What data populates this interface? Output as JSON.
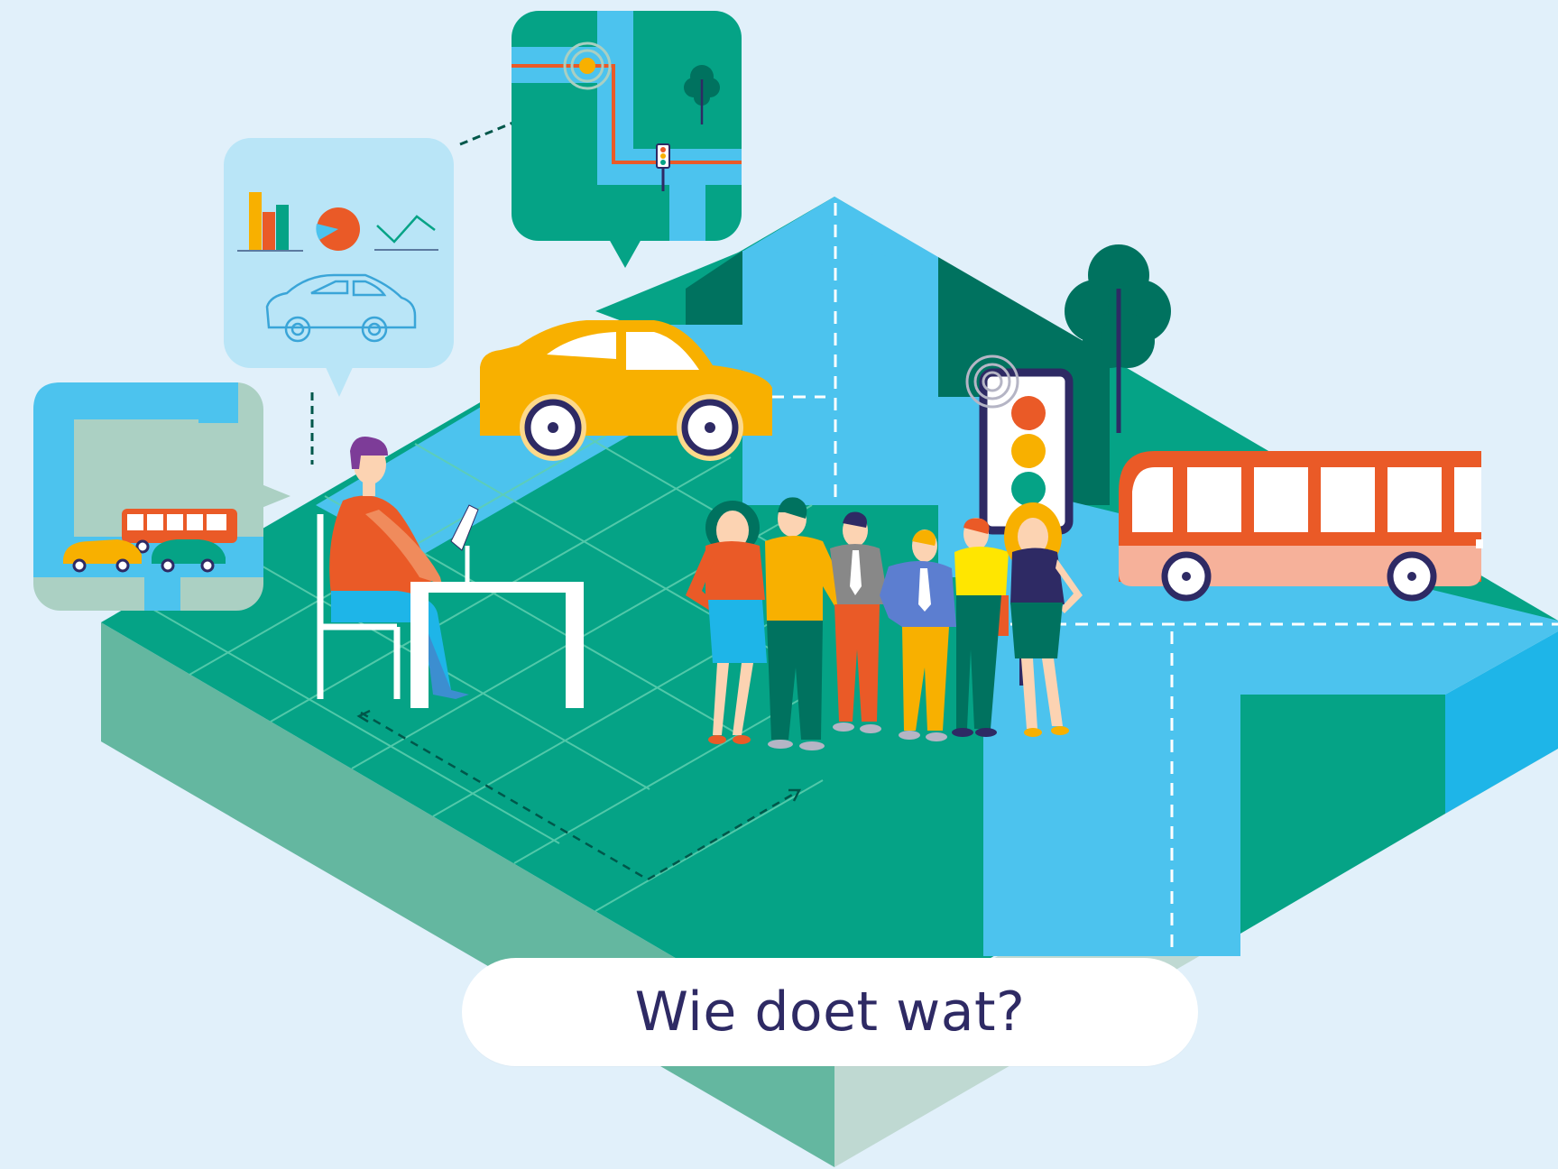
{
  "cta": {
    "label": "Wie doet wat?"
  },
  "colors": {
    "background": "#e1f0fa",
    "ground_green": "#05a386",
    "ground_dark": "#00725f",
    "side_left": "#64b7a0",
    "side_light": "#bfd9d2",
    "road_blue": "#4cc3ee",
    "road_deep": "#1eb5e8",
    "car_yellow": "#f8b000",
    "bus_orange": "#ea5a27",
    "bus_peach": "#f6b19a",
    "navy": "#2e2a64",
    "light_bubble": "#b9e5f7",
    "map_tile_grey": "#abd0c3"
  },
  "icons": [
    "bar-chart-icon",
    "pie-chart-icon",
    "line-chart-icon",
    "car-outline-icon",
    "traffic-light-icon",
    "signal-icon",
    "tree-icon"
  ]
}
